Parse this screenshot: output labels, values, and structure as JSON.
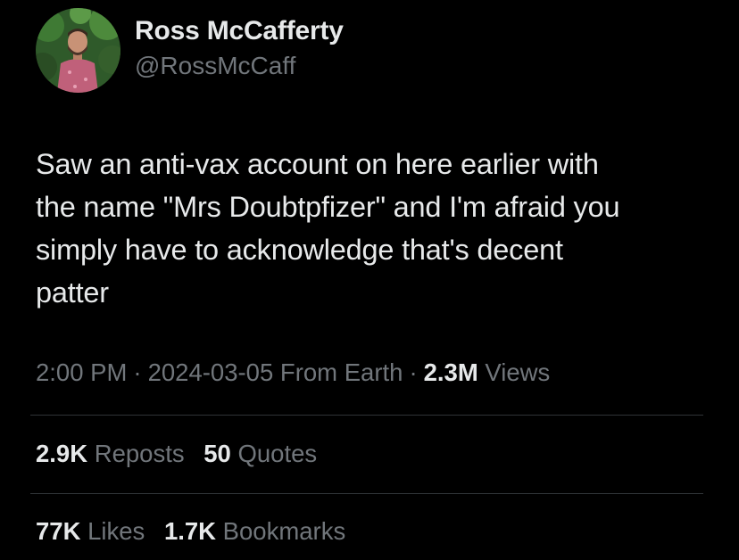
{
  "author": {
    "display_name": "Ross McCafferty",
    "handle": "@RossMcCaff"
  },
  "tweet": {
    "text_lines": [
      "Saw an anti-vax account on here earlier with",
      "the name \"Mrs Doubtpfizer\" and I'm afraid you",
      "simply have to acknowledge that's decent",
      "patter"
    ]
  },
  "meta": {
    "time": "2:00 PM",
    "separator": "·",
    "date": "2024-03-05",
    "source": "From Earth",
    "views_count": "2.3M",
    "views_label": "Views"
  },
  "stats": {
    "reposts_count": "2.9K",
    "reposts_label": "Reposts",
    "quotes_count": "50",
    "quotes_label": "Quotes",
    "likes_count": "77K",
    "likes_label": "Likes",
    "bookmarks_count": "1.7K",
    "bookmarks_label": "Bookmarks"
  },
  "colors": {
    "background": "#000000",
    "primary_text": "#e7e9ea",
    "secondary_text": "#71767b",
    "divider": "#2f3336"
  }
}
